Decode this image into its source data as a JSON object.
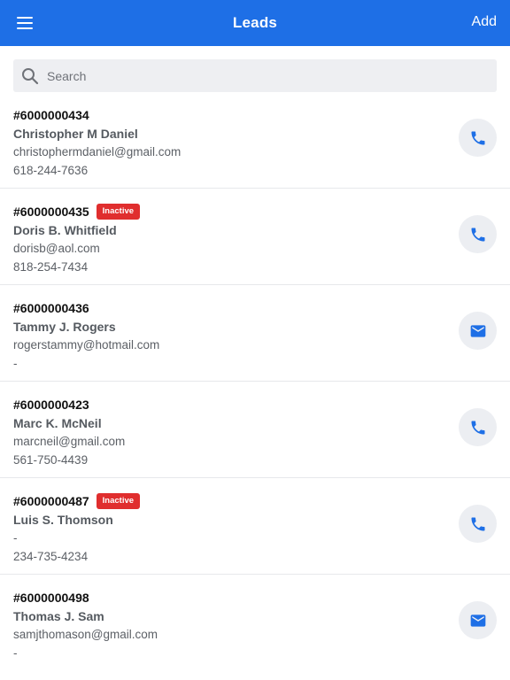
{
  "app_bar": {
    "title": "Leads",
    "add_label": "Add",
    "background_color": "#1e6fe6",
    "menu_icon": "hamburger-menu-icon"
  },
  "search": {
    "placeholder": "Search",
    "value": "",
    "icon": "search-icon"
  },
  "colors": {
    "accent": "#1e6fe6",
    "inactive_badge": "#e02e2e",
    "action_bg": "#eceef2"
  },
  "leads": [
    {
      "id": "#6000000434",
      "status": "",
      "name": "Christopher M Daniel",
      "email": "christophermdaniel@gmail.com",
      "phone": "618-244-7636",
      "action_icon": "phone"
    },
    {
      "id": "#6000000435",
      "status": "Inactive",
      "name": "Doris B. Whitfield",
      "email": "dorisb@aol.com",
      "phone": "818-254-7434",
      "action_icon": "phone"
    },
    {
      "id": "#6000000436",
      "status": "",
      "name": "Tammy J. Rogers",
      "email": "rogerstammy@hotmail.com",
      "phone": "-",
      "action_icon": "mail"
    },
    {
      "id": "#6000000423",
      "status": "",
      "name": "Marc K. McNeil",
      "email": "marcneil@gmail.com",
      "phone": "561-750-4439",
      "action_icon": "phone"
    },
    {
      "id": "#6000000487",
      "status": "Inactive",
      "name": "Luis S. Thomson",
      "email": "-",
      "phone": "234-735-4234",
      "action_icon": "phone"
    },
    {
      "id": "#6000000498",
      "status": "",
      "name": "Thomas J. Sam",
      "email": "samjthomason@gmail.com",
      "phone": "-",
      "action_icon": "mail"
    }
  ]
}
